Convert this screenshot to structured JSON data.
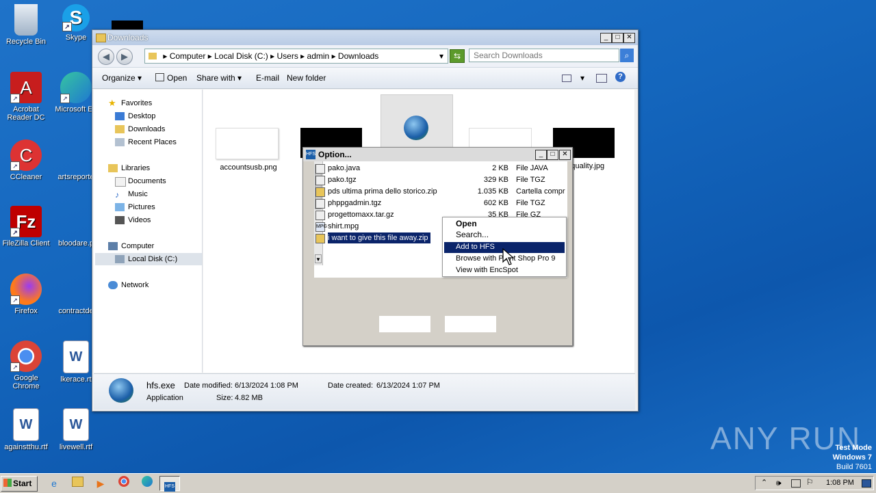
{
  "desktop": {
    "icons": [
      {
        "label": "Recycle Bin"
      },
      {
        "label": "Skype"
      },
      {
        "label": "Acrobat Reader DC"
      },
      {
        "label": "Microsoft Ed"
      },
      {
        "label": "CCleaner"
      },
      {
        "label": "artsreporte"
      },
      {
        "label": "FileZilla Client"
      },
      {
        "label": "bloodare.p"
      },
      {
        "label": "Firefox"
      },
      {
        "label": "contractde"
      },
      {
        "label": "Google Chrome"
      },
      {
        "label": "lkerace.rt"
      },
      {
        "label": "againstthu.rtf"
      },
      {
        "label": "livewell.rtf"
      }
    ],
    "watermark": "ANY RUN",
    "test_mode": [
      "Test Mode",
      "Windows 7",
      "Build 7601"
    ]
  },
  "explorer": {
    "title": "Downloads",
    "breadcrumb": [
      "Computer",
      "Local Disk (C:)",
      "Users",
      "admin",
      "Downloads"
    ],
    "search_placeholder": "Search Downloads",
    "toolbar": {
      "organize": "Organize",
      "open": "Open",
      "share": "Share with",
      "email": "E-mail",
      "new_folder": "New folder"
    },
    "nav": {
      "favorites": "Favorites",
      "desktop": "Desktop",
      "downloads": "Downloads",
      "recent": "Recent Places",
      "libraries": "Libraries",
      "documents": "Documents",
      "music": "Music",
      "pictures": "Pictures",
      "videos": "Videos",
      "computer": "Computer",
      "local_disk": "Local Disk (C:)",
      "network": "Network"
    },
    "files": [
      {
        "name": "accountsusb.png"
      },
      {
        "name": ""
      },
      {
        "name": ""
      },
      {
        "name": ""
      },
      {
        "name": "xquality.jpg"
      }
    ],
    "details": {
      "name": "hfs.exe",
      "type": "Application",
      "modified_label": "Date modified:",
      "modified": "6/13/2024 1:08 PM",
      "created_label": "Date created:",
      "created": "6/13/2024 1:07 PM",
      "size_label": "Size:",
      "size": "4.82 MB"
    }
  },
  "dialog": {
    "title": "Option...",
    "rows": [
      {
        "name": "pako.java",
        "size": "2 KB",
        "type": "File JAVA"
      },
      {
        "name": "pako.tgz",
        "size": "329 KB",
        "type": "File TGZ"
      },
      {
        "name": "pds ultima prima dello storico.zip",
        "size": "1.035 KB",
        "type": "Cartella compr"
      },
      {
        "name": "phppgadmin.tgz",
        "size": "602 KB",
        "type": "File TGZ"
      },
      {
        "name": "progettomaxx.tar.gz",
        "size": "35 KB",
        "type": "File GZ"
      },
      {
        "name": "shirt.mpg",
        "size": "",
        "type": ""
      },
      {
        "name": "i want to give this file away.zip",
        "size": "",
        "type": ""
      }
    ]
  },
  "context_menu": {
    "items": [
      "Open",
      "Search...",
      "Add to HFS",
      "Browse with Paint Shop Pro 9",
      "View with EncSpot"
    ]
  },
  "taskbar": {
    "start": "Start",
    "clock": "1:08 PM"
  }
}
